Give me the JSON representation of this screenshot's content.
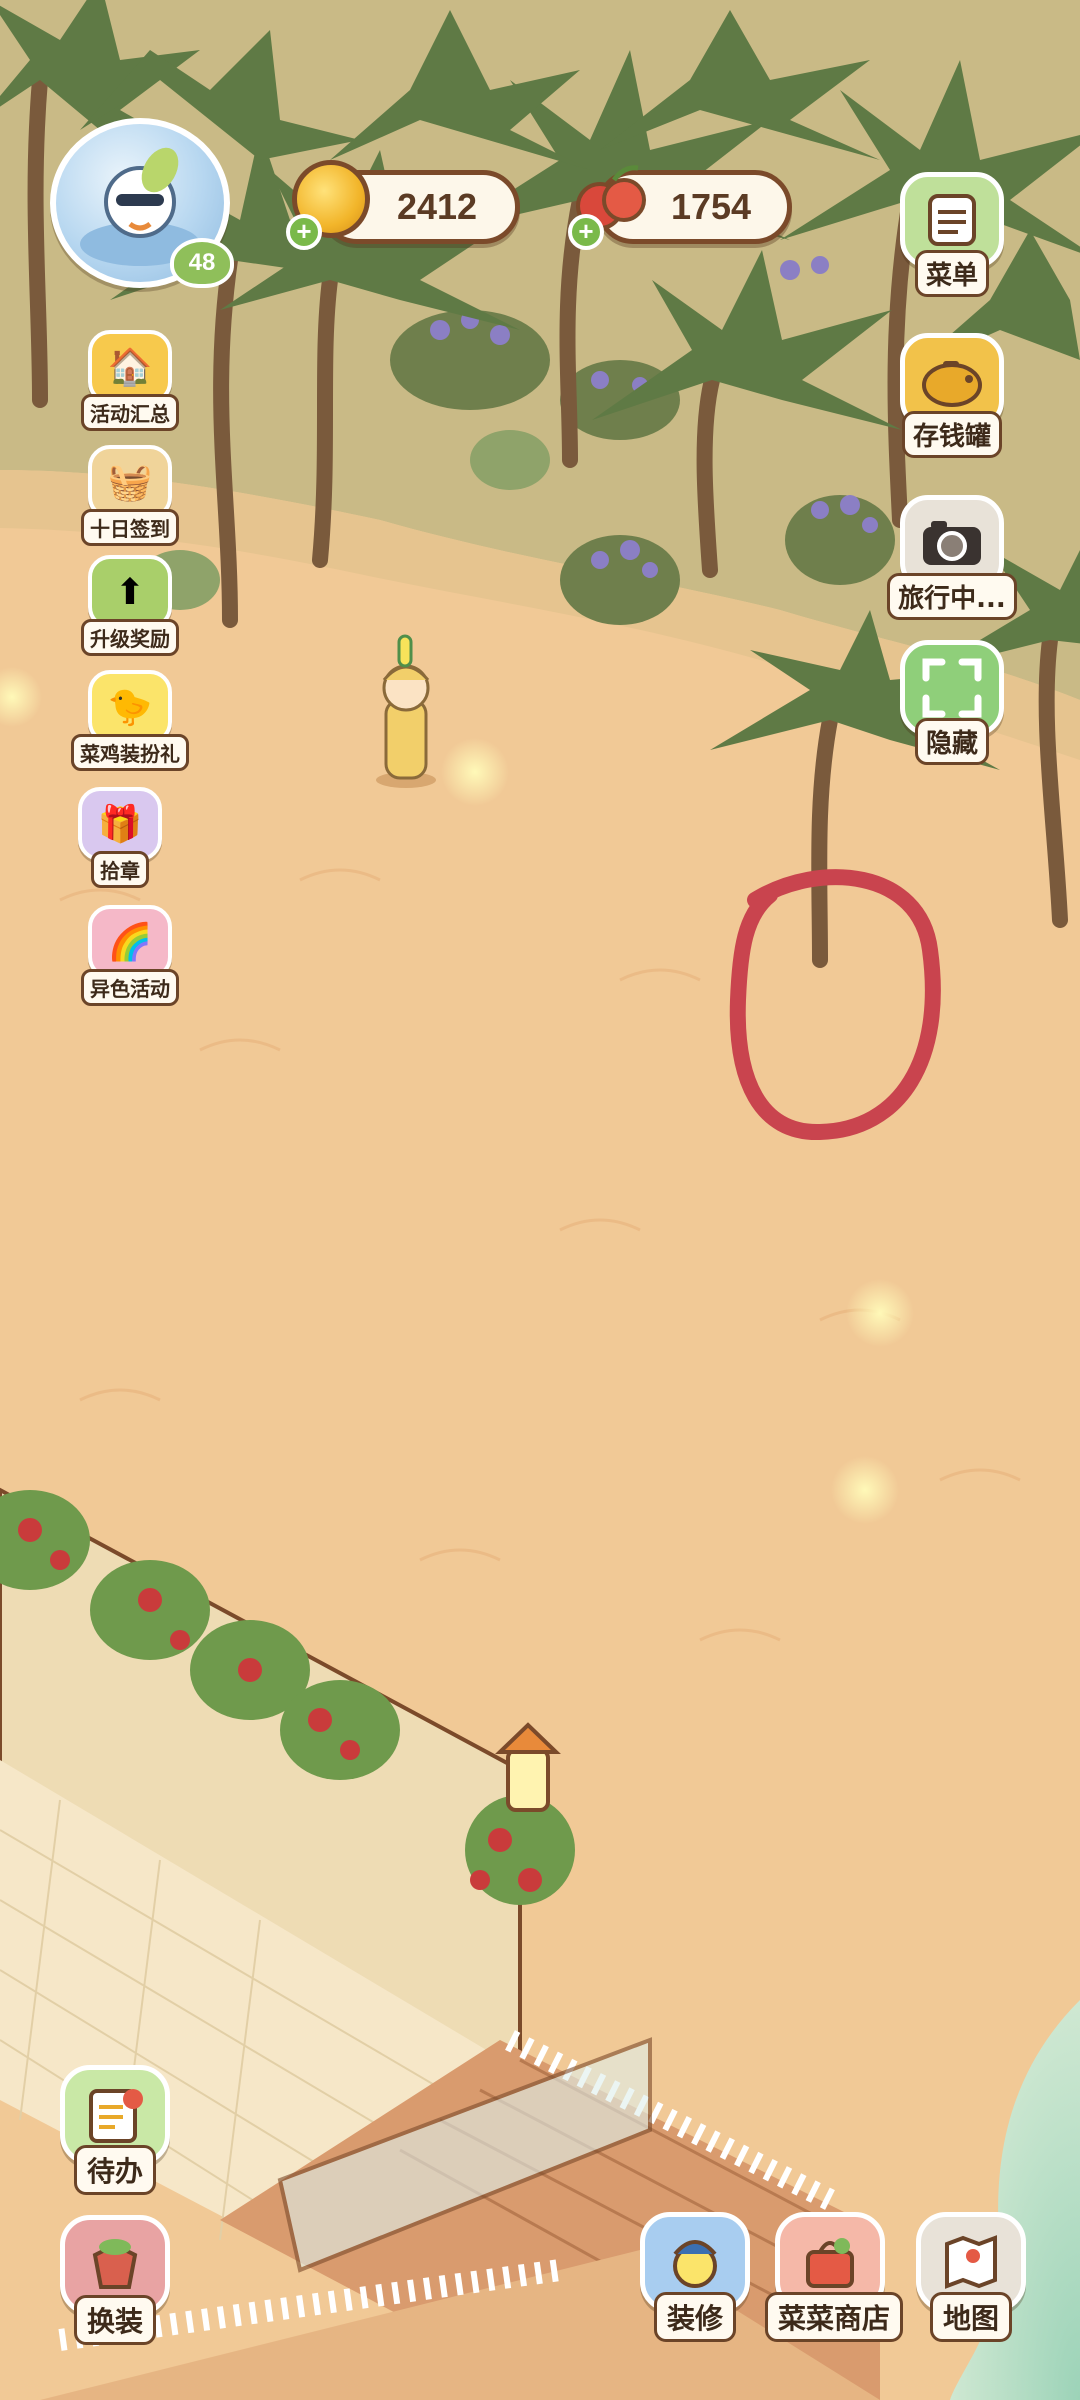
{
  "player": {
    "level": "48"
  },
  "currencies": {
    "coins": "2412",
    "fruit": "1754"
  },
  "left_menu": [
    {
      "label": "活动汇总",
      "icon": "event-summary-icon"
    },
    {
      "label": "十日签到",
      "icon": "ten-day-checkin-icon"
    },
    {
      "label": "升级奖励",
      "icon": "level-reward-icon"
    },
    {
      "label": "菜鸡装扮礼",
      "icon": "duck-outfit-gift-icon"
    },
    {
      "label": "拾章",
      "icon": "collect-badge-icon"
    },
    {
      "label": "异色活动",
      "icon": "color-variant-event-icon"
    }
  ],
  "right_menu": [
    {
      "label": "菜单",
      "icon": "menu-icon"
    },
    {
      "label": "存钱罐",
      "icon": "piggy-bank-icon"
    },
    {
      "label": "旅行中...",
      "icon": "camera-travel-icon"
    },
    {
      "label": "隐藏",
      "icon": "hide-ui-icon"
    }
  ],
  "bottom_left": [
    {
      "label": "待办",
      "icon": "todo-icon"
    },
    {
      "label": "换装",
      "icon": "wardrobe-icon"
    }
  ],
  "bottom_right": [
    {
      "label": "装修",
      "icon": "decorate-icon"
    },
    {
      "label": "菜菜商店",
      "icon": "shop-icon"
    },
    {
      "label": "地图",
      "icon": "map-icon"
    }
  ],
  "colors": {
    "sand": "#f1c996",
    "grass": "#c6b883",
    "palm": "#5f7a45",
    "annotation_circle": "#c9444e",
    "label_border": "#6b4428"
  }
}
